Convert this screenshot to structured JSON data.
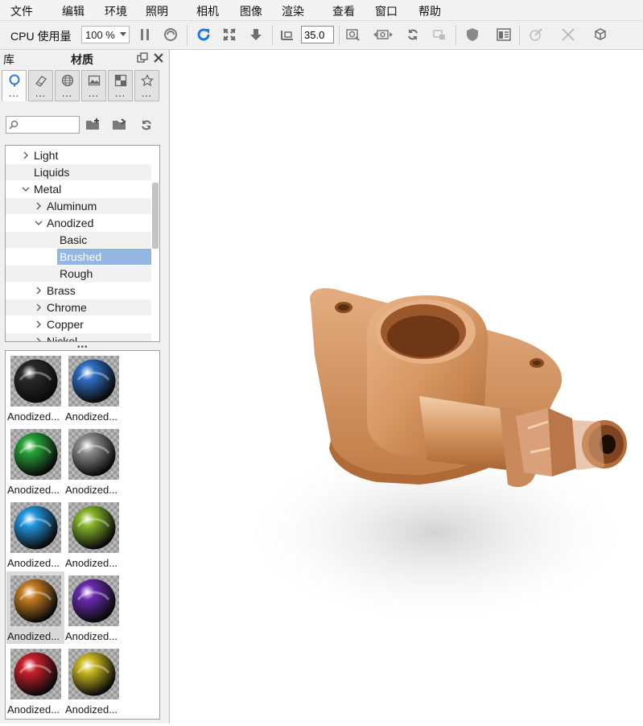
{
  "menu": [
    "文件",
    "编辑",
    "环境",
    "照明",
    "相机",
    "图像",
    "渲染",
    "查看",
    "窗口",
    "帮助"
  ],
  "toolbar": {
    "cpu_label": "CPU 使用量",
    "cpu_value": "100 %",
    "fov_value": "35.0"
  },
  "panel": {
    "library_label": "库",
    "title": "材质"
  },
  "tree": {
    "items": [
      {
        "label": "Light",
        "expanded": false
      },
      {
        "label": "Liquids"
      },
      {
        "label": "Metal",
        "expanded": true
      },
      {
        "label": "Aluminum",
        "expanded": false
      },
      {
        "label": "Anodized",
        "expanded": true
      },
      {
        "label": "Basic"
      },
      {
        "label": "Brushed",
        "selected": true
      },
      {
        "label": "Rough"
      },
      {
        "label": "Brass",
        "expanded": false
      },
      {
        "label": "Chrome",
        "expanded": false
      },
      {
        "label": "Copper",
        "expanded": false
      },
      {
        "label": "Nickel",
        "expanded": false
      }
    ]
  },
  "materials": [
    {
      "label": "Anodized...",
      "color": "#2a2a2a"
    },
    {
      "label": "Anodized...",
      "color": "#2f6fc4"
    },
    {
      "label": "Anodized...",
      "color": "#27a336"
    },
    {
      "label": "Anodized...",
      "color": "#8c8c8c"
    },
    {
      "label": "Anodized...",
      "color": "#2196dd"
    },
    {
      "label": "Anodized...",
      "color": "#86b52b"
    },
    {
      "label": "Anodized...",
      "color": "#c57d22",
      "selected": true
    },
    {
      "label": "Anodized...",
      "color": "#6a2bb0"
    },
    {
      "label": "Anodized...",
      "color": "#c8202a"
    },
    {
      "label": "Anodized...",
      "color": "#c9b820"
    }
  ],
  "colors": {
    "selection": "#94b6e3",
    "model": "#d89a66"
  }
}
